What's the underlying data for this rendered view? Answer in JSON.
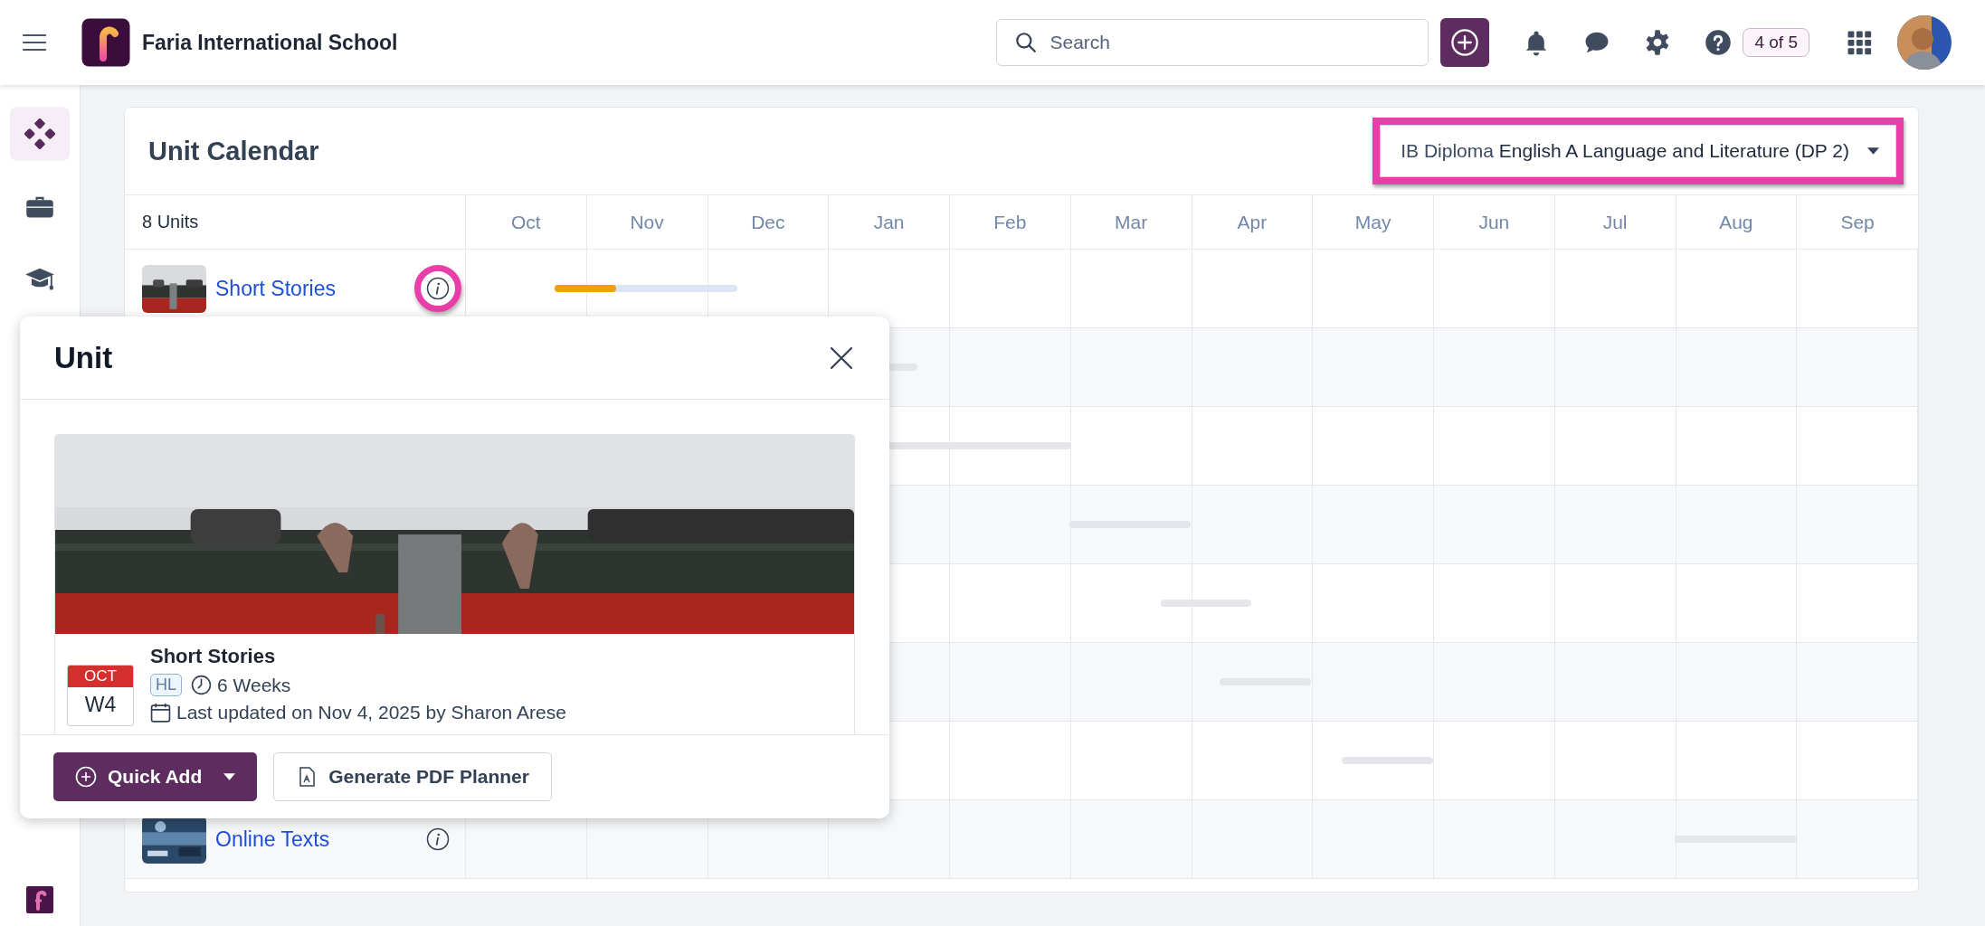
{
  "topbar": {
    "school": "Faria International School",
    "search": {
      "placeholder": "Search"
    },
    "tour_badge": "4 of 5"
  },
  "sidebar": {
    "items": [
      {
        "kind": "dashboard",
        "selected": true
      },
      {
        "kind": "portfolio",
        "selected": false
      },
      {
        "kind": "courses",
        "selected": false
      }
    ]
  },
  "calendar": {
    "title": "Unit Calendar",
    "course_select": {
      "program": "IB Diploma",
      "course": "English A Language and Literature (DP 2)",
      "highlighted": true
    },
    "units_count": "8 Units",
    "months": [
      "Oct",
      "Nov",
      "Dec",
      "Jan",
      "Feb",
      "Mar",
      "Apr",
      "May",
      "Jun",
      "Jul",
      "Aug",
      "Sep"
    ],
    "units": [
      {
        "name": "Short Stories",
        "level": 0.34,
        "info_highlighted": true
      },
      {
        "name": "Online Texts",
        "info_highlighted": false
      }
    ]
  },
  "unit_popup": {
    "title": "Unit",
    "unit": {
      "month": "OCT",
      "week": "W4",
      "name": "Short Stories",
      "level_tag": "HL",
      "duration": "6 Weeks",
      "updated": "Last updated on Nov 4, 2025 by Sharon Arese"
    },
    "actions": [
      {
        "label": "Quick Add",
        "kind": "primary"
      },
      {
        "label": "Generate PDF Planner",
        "kind": "secondary"
      }
    ]
  }
}
